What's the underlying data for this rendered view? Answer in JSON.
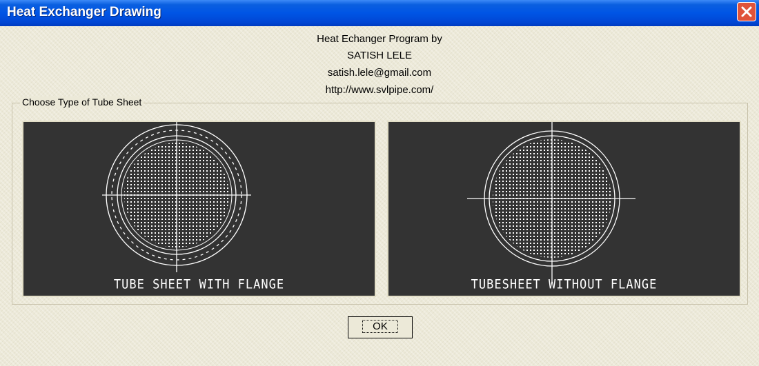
{
  "window": {
    "title": "Heat Exchanger Drawing"
  },
  "credits": {
    "line1": "Heat Echanger Program by",
    "line2": "SATISH LELE",
    "line3": "satish.lele@gmail.com",
    "line4": "http://www.svlpipe.com/"
  },
  "group": {
    "label": "Choose Type of Tube Sheet"
  },
  "options": [
    {
      "caption": "TUBE SHEET WITH FLANGE"
    },
    {
      "caption": "TUBESHEET WITHOUT FLANGE"
    }
  ],
  "buttons": {
    "ok": "OK"
  },
  "icons": {
    "close": "close-icon"
  },
  "colors": {
    "titlebar": "#0055e5",
    "panel": "#333333",
    "drawing": "#ffffff",
    "close": "#e0533a"
  }
}
